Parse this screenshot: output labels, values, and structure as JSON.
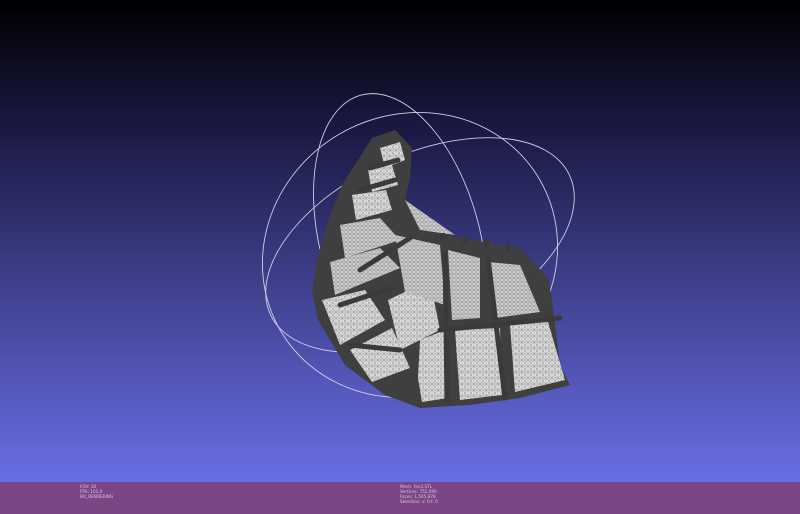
{
  "viewport": {
    "background_top": "#000000",
    "background_bottom": "#6a6ee6",
    "mesh_color": "#3f3f3f",
    "wireframe_color": "#e6e6e6",
    "trackball_color": "#cfcfe8"
  },
  "status_bar": {
    "background": "#7c4585",
    "left_info": {
      "fov": "FOV: 30",
      "fps": "FPS:  101.0",
      "renderer": "BO_RENDERING"
    },
    "center_info": {
      "mesh": "Mesh: fan2.STL",
      "vertices": "Vertices: 752,090",
      "faces": "Faces: 1,505,878",
      "selection": "Selection: v: 0 f: 0"
    }
  }
}
